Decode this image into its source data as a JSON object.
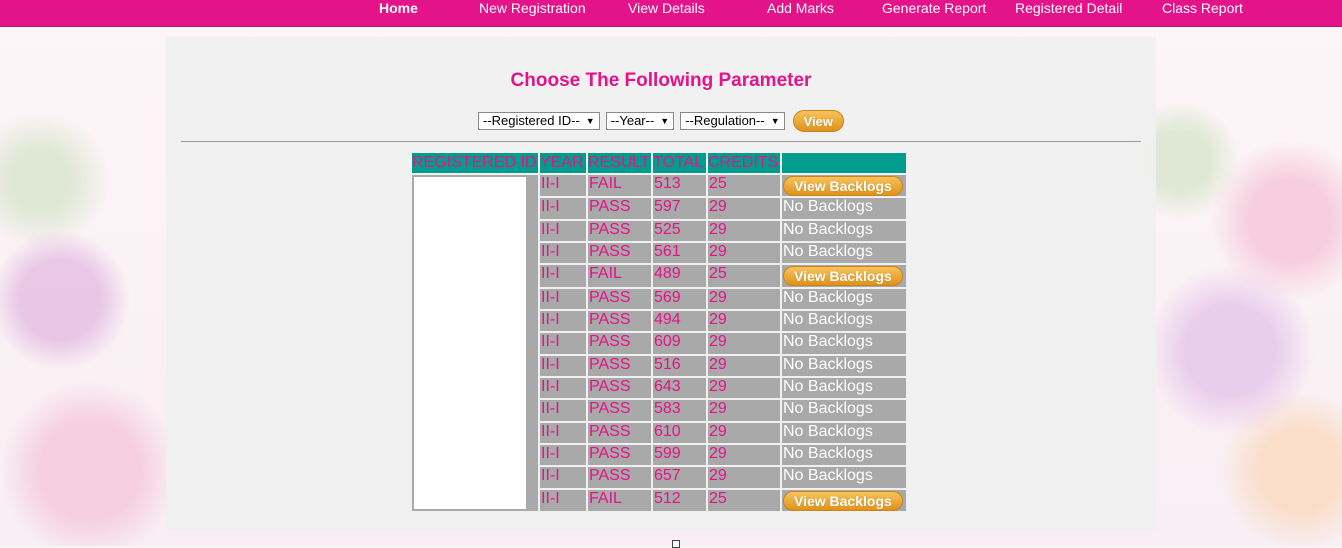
{
  "nav": {
    "items": [
      {
        "label": "Home",
        "active": true
      },
      {
        "label": "New Registration"
      },
      {
        "label": "View Details"
      },
      {
        "label": "Add Marks"
      },
      {
        "label": "Generate Report"
      },
      {
        "label": "Registered Detail"
      },
      {
        "label": "Class Report"
      }
    ]
  },
  "page": {
    "title": "Choose The Following Parameter"
  },
  "filters": {
    "registered_id": "--Registered ID--",
    "year": "--Year--",
    "regulation": "--Regulation--",
    "view_label": "View"
  },
  "table": {
    "headers": [
      "REGISTERED ID",
      "YEAR",
      "RESULT",
      "TOTAL",
      "CREDITS",
      ""
    ],
    "rows": [
      {
        "year": "II-I",
        "result": "FAIL",
        "total": "513",
        "credits": "25",
        "action": "View Backlogs"
      },
      {
        "year": "II-I",
        "result": "PASS",
        "total": "597",
        "credits": "29",
        "action": "No Backlogs"
      },
      {
        "year": "II-I",
        "result": "PASS",
        "total": "525",
        "credits": "29",
        "action": "No Backlogs"
      },
      {
        "year": "II-I",
        "result": "PASS",
        "total": "561",
        "credits": "29",
        "action": "No Backlogs"
      },
      {
        "year": "II-I",
        "result": "FAIL",
        "total": "489",
        "credits": "25",
        "action": "View Backlogs"
      },
      {
        "year": "II-I",
        "result": "PASS",
        "total": "569",
        "credits": "29",
        "action": "No Backlogs"
      },
      {
        "year": "II-I",
        "result": "PASS",
        "total": "494",
        "credits": "29",
        "action": "No Backlogs"
      },
      {
        "year": "II-I",
        "result": "PASS",
        "total": "609",
        "credits": "29",
        "action": "No Backlogs"
      },
      {
        "year": "II-I",
        "result": "PASS",
        "total": "516",
        "credits": "29",
        "action": "No Backlogs"
      },
      {
        "year": "II-I",
        "result": "PASS",
        "total": "643",
        "credits": "29",
        "action": "No Backlogs"
      },
      {
        "year": "II-I",
        "result": "PASS",
        "total": "583",
        "credits": "29",
        "action": "No Backlogs"
      },
      {
        "year": "II-I",
        "result": "PASS",
        "total": "610",
        "credits": "29",
        "action": "No Backlogs"
      },
      {
        "year": "II-I",
        "result": "PASS",
        "total": "599",
        "credits": "29",
        "action": "No Backlogs"
      },
      {
        "year": "II-I",
        "result": "PASS",
        "total": "657",
        "credits": "29",
        "action": "No Backlogs"
      },
      {
        "year": "II-I",
        "result": "FAIL",
        "total": "512",
        "credits": "25",
        "action": "View Backlogs"
      }
    ]
  },
  "colors": {
    "brand": "#e5138a",
    "header_bg": "#009d8c",
    "cell_bg": "#a9a9a9",
    "button": "#eea534"
  }
}
